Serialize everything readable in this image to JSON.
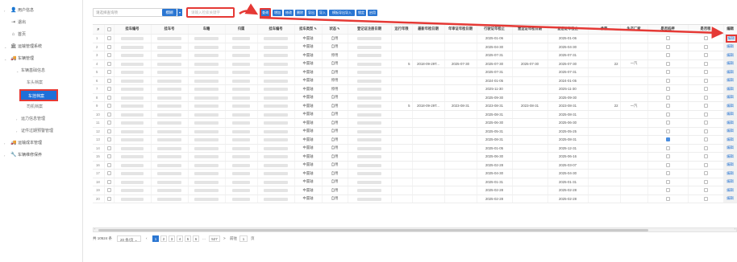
{
  "sidebar": {
    "items": [
      {
        "label": "用户信息",
        "icon": "user-icon"
      },
      {
        "label": "退出",
        "icon": "logout-icon"
      },
      {
        "label": "首页",
        "icon": "home-icon"
      },
      {
        "label": "运输管理系统",
        "icon": "bank-icon"
      },
      {
        "label": "车辆管理",
        "icon": "truck-icon"
      },
      {
        "label": "车辆基础信息"
      },
      {
        "label": "车头档案"
      },
      {
        "label": "车挂档案"
      },
      {
        "label": "司机档案"
      },
      {
        "label": "运力信息管理"
      },
      {
        "label": "证件过期预警管理"
      },
      {
        "label": "运输成本管理",
        "icon": "truck-icon"
      },
      {
        "label": "车辆维修保养",
        "icon": "wrench-icon"
      }
    ]
  },
  "toolbar": {
    "select_placeholder": "请选择查询项",
    "mode_label": "模糊",
    "search_placeholder": "请输入检索关键字",
    "buttons": [
      "查询",
      "增加",
      "修改",
      "删除",
      "导出",
      "导入",
      "模板导出导入",
      "锁定",
      "启用"
    ]
  },
  "table": {
    "headers": [
      "#",
      "",
      "挂车编号",
      "挂车号",
      "车籍",
      "归属",
      "挂车编号",
      "挂车类型",
      "状态",
      "登记证注册日期",
      "运行年限",
      "最新年检日期",
      "年审证年检日期",
      "行驶证年检止",
      "营运证年检日期",
      "营运证年检止",
      "承载",
      "生产厂家",
      "是否抵押",
      "是否租",
      "编辑"
    ],
    "rows": [
      {
        "n": "1",
        "type": "中置轴",
        "status": "自用",
        "reg": "",
        "years": "",
        "d1": "",
        "d2": "",
        "d3": "2025-01-06",
        "d4": "",
        "d5": "2025-01-06",
        "load": "",
        "maker": "",
        "mortgage": false
      },
      {
        "n": "2",
        "type": "中置轴",
        "status": "自用",
        "reg": "",
        "years": "",
        "d1": "",
        "d2": "",
        "d3": "2025-04-30",
        "d4": "",
        "d5": "2025-04-30",
        "load": "",
        "maker": "",
        "mortgage": false
      },
      {
        "n": "3",
        "type": "中置轴",
        "status": "停用",
        "reg": "",
        "years": "",
        "d1": "",
        "d2": "",
        "d3": "2025-07-31",
        "d4": "",
        "d5": "2025-07-31",
        "load": "",
        "maker": "",
        "mortgage": false
      },
      {
        "n": "4",
        "type": "中置轴",
        "status": "自用",
        "reg": "",
        "years": "5",
        "d1": "2018-09-29T...",
        "d2": "2025-07-30",
        "d3": "2025-07-30",
        "d4": "2025-07-30",
        "d5": "2025-07-30",
        "load": "22",
        "maker": "一汽",
        "mortgage": false
      },
      {
        "n": "5",
        "type": "中置轴",
        "status": "自用",
        "reg": "",
        "years": "",
        "d1": "",
        "d2": "",
        "d3": "2025-07-31",
        "d4": "",
        "d5": "2025-07-31",
        "load": "",
        "maker": "",
        "mortgage": false
      },
      {
        "n": "6",
        "type": "中置轴",
        "status": "停用",
        "reg": "",
        "years": "",
        "d1": "",
        "d2": "",
        "d3": "2024-01-05",
        "d4": "",
        "d5": "2024-01-05",
        "load": "",
        "maker": "",
        "mortgage": false
      },
      {
        "n": "7",
        "type": "中置轴",
        "status": "停用",
        "reg": "",
        "years": "",
        "d1": "",
        "d2": "",
        "d3": "2025-11-30",
        "d4": "",
        "d5": "2025-11-30",
        "load": "",
        "maker": "",
        "mortgage": false
      },
      {
        "n": "8",
        "type": "中置轴",
        "status": "自用",
        "reg": "",
        "years": "",
        "d1": "",
        "d2": "",
        "d3": "2025-09-30",
        "d4": "",
        "d5": "2025-09-30",
        "load": "",
        "maker": "",
        "mortgage": false
      },
      {
        "n": "9",
        "type": "中置轴",
        "status": "自用",
        "reg": "",
        "years": "5",
        "d1": "2018-09-29T...",
        "d2": "2023-08-31",
        "d3": "2023-08-31",
        "d4": "2023-08-31",
        "d5": "2023-08-31",
        "load": "22",
        "maker": "一汽",
        "mortgage": false
      },
      {
        "n": "10",
        "type": "中置轴",
        "status": "自用",
        "reg": "",
        "years": "",
        "d1": "",
        "d2": "",
        "d3": "2025-08-31",
        "d4": "",
        "d5": "2025-08-31",
        "load": "",
        "maker": "",
        "mortgage": false
      },
      {
        "n": "11",
        "type": "中置轴",
        "status": "自用",
        "reg": "",
        "years": "",
        "d1": "",
        "d2": "",
        "d3": "2025-06-30",
        "d4": "",
        "d5": "2025-06-30",
        "load": "",
        "maker": "",
        "mortgage": false
      },
      {
        "n": "12",
        "type": "中置轴",
        "status": "自用",
        "reg": "",
        "years": "",
        "d1": "",
        "d2": "",
        "d3": "2025-05-31",
        "d4": "",
        "d5": "2025-05-25",
        "load": "",
        "maker": "",
        "mortgage": false
      },
      {
        "n": "13",
        "type": "中置轴",
        "status": "自用",
        "reg": "",
        "years": "",
        "d1": "",
        "d2": "",
        "d3": "2025-08-31",
        "d4": "",
        "d5": "2025-08-31",
        "load": "",
        "maker": "",
        "mortgage": true
      },
      {
        "n": "14",
        "type": "中置轴",
        "status": "自用",
        "reg": "",
        "years": "",
        "d1": "",
        "d2": "",
        "d3": "2025-01-05",
        "d4": "",
        "d5": "2025-12-31",
        "load": "",
        "maker": "",
        "mortgage": false
      },
      {
        "n": "15",
        "type": "中置轴",
        "status": "自用",
        "reg": "",
        "years": "",
        "d1": "",
        "d2": "",
        "d3": "2025-06-30",
        "d4": "",
        "d5": "2025-06-16",
        "load": "",
        "maker": "",
        "mortgage": false
      },
      {
        "n": "16",
        "type": "中置轴",
        "status": "自用",
        "reg": "",
        "years": "",
        "d1": "",
        "d2": "",
        "d3": "2025-02-28",
        "d4": "",
        "d5": "2025-03-07",
        "load": "",
        "maker": "",
        "mortgage": false
      },
      {
        "n": "17",
        "type": "中置轴",
        "status": "自用",
        "reg": "",
        "years": "",
        "d1": "",
        "d2": "",
        "d3": "2025-04-30",
        "d4": "",
        "d5": "2025-04-30",
        "load": "",
        "maker": "",
        "mortgage": false
      },
      {
        "n": "18",
        "type": "中置轴",
        "status": "自用",
        "reg": "",
        "years": "",
        "d1": "",
        "d2": "",
        "d3": "2025-01-31",
        "d4": "",
        "d5": "2025-01-31",
        "load": "",
        "maker": "",
        "mortgage": false
      },
      {
        "n": "19",
        "type": "中置轴",
        "status": "自用",
        "reg": "",
        "years": "",
        "d1": "",
        "d2": "",
        "d3": "2025-02-28",
        "d4": "",
        "d5": "2025-02-28",
        "load": "",
        "maker": "",
        "mortgage": false
      },
      {
        "n": "20",
        "type": "中置轴",
        "status": "自用",
        "reg": "",
        "years": "",
        "d1": "",
        "d2": "",
        "d3": "2025-02-28",
        "d4": "",
        "d5": "2025-02-28",
        "load": "",
        "maker": "",
        "mortgage": false
      }
    ],
    "edit_label": "编辑"
  },
  "pager": {
    "total": "共 10524 条",
    "page_size": "20 条/页",
    "pages": [
      "1",
      "2",
      "3",
      "4",
      "5",
      "6",
      "...",
      "527"
    ],
    "next": ">",
    "goto_label": "前往",
    "goto_value": "1",
    "page_suffix": "页"
  },
  "colors": {
    "accent": "#2a76d2",
    "highlight": "#e53935"
  }
}
